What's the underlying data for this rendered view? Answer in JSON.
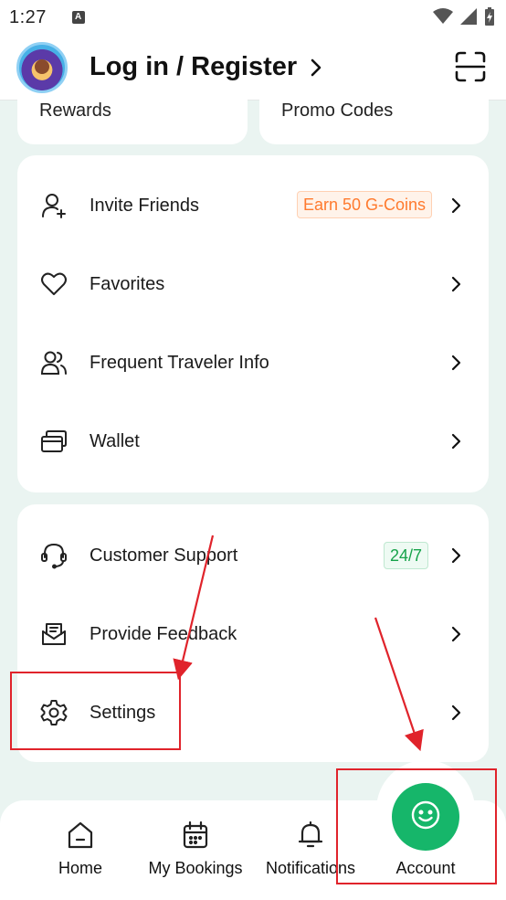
{
  "status_bar": {
    "time": "1:27"
  },
  "header": {
    "login_text": "Log in / Register"
  },
  "top_cards": {
    "rewards": "Rewards",
    "promo_codes": "Promo Codes"
  },
  "menu_group_1": [
    {
      "label": "Invite Friends",
      "icon": "add-person-icon",
      "badge": "Earn 50 G-Coins"
    },
    {
      "label": "Favorites",
      "icon": "heart-icon"
    },
    {
      "label": "Frequent Traveler Info",
      "icon": "people-icon"
    },
    {
      "label": "Wallet",
      "icon": "wallet-icon"
    }
  ],
  "menu_group_2": [
    {
      "label": "Customer Support",
      "icon": "headset-icon",
      "badge": "24/7"
    },
    {
      "label": "Provide Feedback",
      "icon": "feedback-icon"
    },
    {
      "label": "Settings",
      "icon": "gear-icon"
    }
  ],
  "bottom_nav": [
    {
      "label": "Home",
      "icon": "home-icon"
    },
    {
      "label": "My Bookings",
      "icon": "calendar-icon"
    },
    {
      "label": "Notifications",
      "icon": "bell-icon"
    },
    {
      "label": "Account",
      "icon": "smiley-icon",
      "active": true
    }
  ],
  "colors": {
    "accent_green": "#16b66a",
    "badge_orange": "#ff7a2e",
    "badge_green": "#16a34a",
    "annotation_red": "#e0232b",
    "background": "#eaf4f1"
  }
}
